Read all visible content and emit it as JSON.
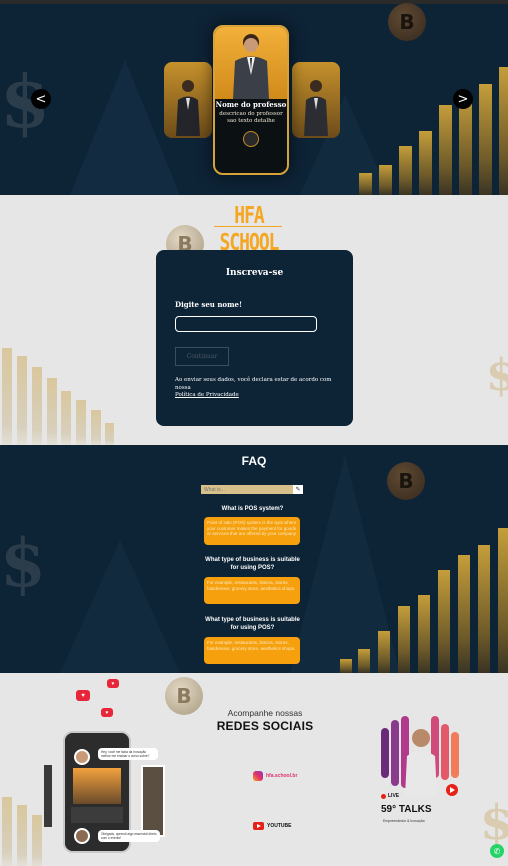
{
  "hero": {
    "prev_label": "<",
    "next_label": ">",
    "coin_symbol": "B",
    "dollar_symbol": "$",
    "featured_card": {
      "name": "Nome do professo",
      "description": "descricao do professor sao texto detalhe"
    }
  },
  "signup": {
    "brand": "HFA SCHOOL",
    "coin_symbol": "B",
    "title": "Inscreva-se",
    "name_label": "Digite seu nome!",
    "name_value": "",
    "continue_label": "Continuar",
    "terms_text": "Ao enviar seus dados, você declara estar de acordo com nossa",
    "privacy_link": "Política de Privacidade"
  },
  "faq": {
    "title": "FAQ",
    "search_placeholder": "What is...",
    "search_icon": "pencil-icon",
    "items": [
      {
        "question": "What is POS system?",
        "answer": "Point of sale (POS) system is the spot where your customer makes the payment for goods or services that are offered by your company."
      },
      {
        "question": "What type of business is suitable for using POS?",
        "answer": "For example, restaurants, bistros, stores, hairdresser, grocery store, aesthetics shops."
      },
      {
        "question": "What type of business is suitable for using POS?",
        "answer": "For example, restaurants, bistros, stores, hairdresser, grocery store, aesthetics shops."
      }
    ]
  },
  "social": {
    "subtitle": "Acompanhe nossas",
    "title": "REDES SOCIAIS",
    "instagram_label": "hfa.school.br",
    "youtube_label": "YOUTUBE",
    "coin_symbol": "B",
    "chat": {
      "bubble_1": "Hey, você me fazia da Inovação melhor me ensinar o curso sobre?",
      "bubble_2": "Obrigado, aprendi algo essencial direto com o evento!"
    },
    "podcast": {
      "live_label": "LIVE",
      "title": "59° TALKS",
      "subtitle": "Empreendedor & Inovação"
    },
    "whatsapp_icon": "whatsapp-icon"
  },
  "colors": {
    "navy": "#0d2336",
    "accent": "#f5a623",
    "faq_answer_bg": "#f5a00c",
    "light_bg": "#e6e6e6"
  }
}
